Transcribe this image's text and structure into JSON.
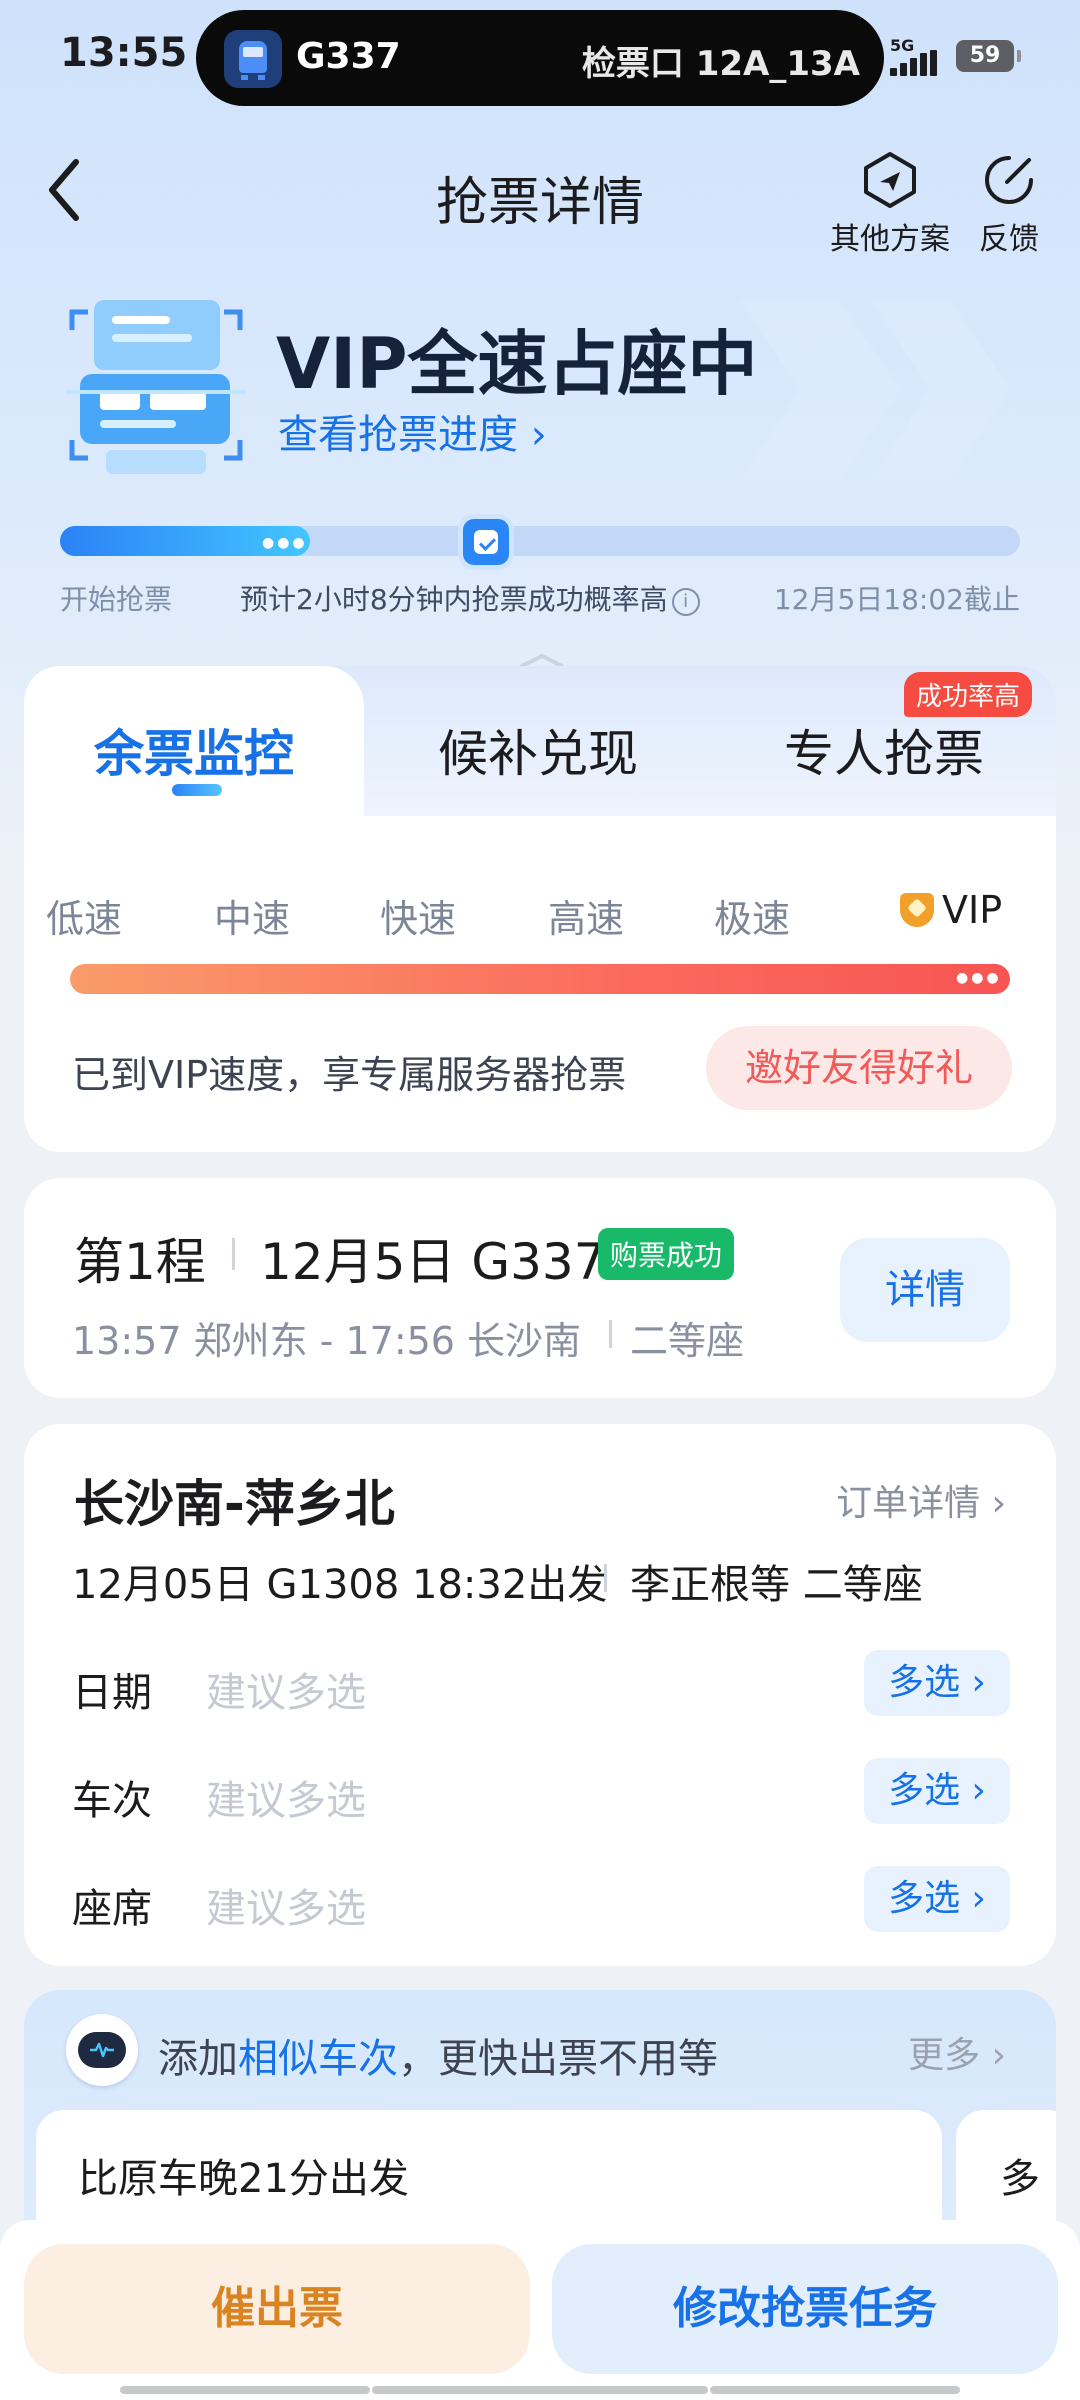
{
  "status_bar": {
    "time": "13:55",
    "network": "5G",
    "battery": "59",
    "live_activity": {
      "train": "G337",
      "gate": "检票口 12A_13A"
    }
  },
  "header": {
    "title": "抢票详情",
    "actions": [
      {
        "label": "其他方案",
        "icon": "navigation-icon"
      },
      {
        "label": "反馈",
        "icon": "edit-icon"
      }
    ]
  },
  "hero": {
    "title": "VIP全速占座中",
    "link": "查看抢票进度 ›"
  },
  "progress": {
    "start_label": "开始抢票",
    "estimate_text": "预计2小时8分钟内抢票成功概率高",
    "deadline_label": "12月5日18:02截止",
    "fraction": 0.4
  },
  "monitor": {
    "tabs": [
      {
        "label": "余票监控",
        "active": true
      },
      {
        "label": "候补兑现",
        "active": false
      },
      {
        "label": "专人抢票",
        "active": false,
        "badge": "成功率高"
      }
    ],
    "speed_levels": [
      "低速",
      "中速",
      "快速",
      "高速",
      "极速",
      "VIP"
    ],
    "current_level": "VIP",
    "speed_note": "已到VIP速度，享专属服务器抢票",
    "invite_button": "邀好友得好礼"
  },
  "trip": {
    "leg": "第1程",
    "date_train": "12月5日 G337",
    "status": "购票成功",
    "times": "13:57 郑州东 - 17:56 长沙南",
    "seat": "二等座",
    "detail_button": "详情"
  },
  "order": {
    "route": "长沙南-萍乡北",
    "detail_link": "订单详情 ›",
    "info": "12月05日 G1308 18:32出发",
    "passengers": "李正根等 二等座",
    "options": [
      {
        "label": "日期",
        "placeholder": "建议多选",
        "button": "多选 ›"
      },
      {
        "label": "车次",
        "placeholder": "建议多选",
        "button": "多选 ›"
      },
      {
        "label": "座席",
        "placeholder": "建议多选",
        "button": "多选 ›"
      }
    ]
  },
  "similar": {
    "prefix": "添加",
    "highlight": "相似车次",
    "suffix": "，更快出票不用等",
    "more": "更多 ›",
    "items": [
      "比原车晚21分出发",
      "多"
    ]
  },
  "bottom": {
    "urge_button": "催出票",
    "modify_button": "修改抢票任务"
  },
  "colors": {
    "accent": "#1672e6",
    "success": "#19b96a",
    "danger": "#f54b40",
    "warning": "#d98421"
  }
}
